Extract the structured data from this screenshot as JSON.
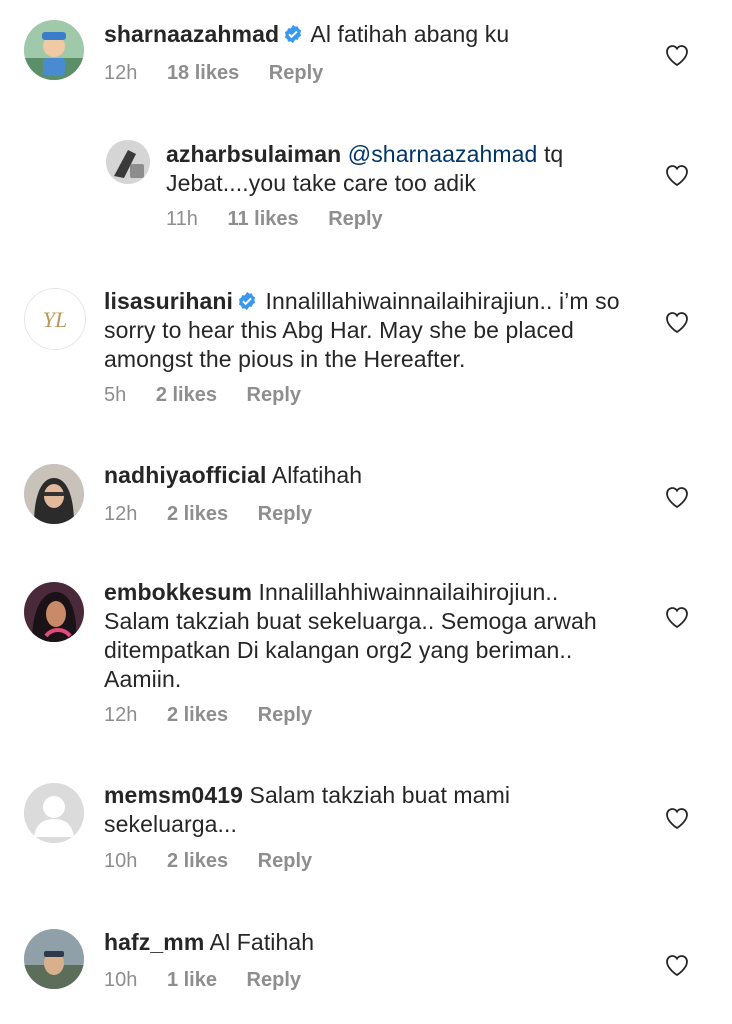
{
  "comments": [
    {
      "username": "sharnaazahmad",
      "verified": true,
      "text": "Al fatihah abang ku",
      "time": "12h",
      "likes": "18 likes",
      "reply": "Reply",
      "avatar_icon": "avatar-child-photo"
    },
    {
      "username": "azharbsulaiman",
      "verified": false,
      "mention": "@sharnaazahmad",
      "text": " tq Jebat....you take care too adik",
      "time": "11h",
      "likes": "11 likes",
      "reply": "Reply",
      "avatar_icon": "avatar-photo"
    },
    {
      "username": "lisasurihani",
      "verified": true,
      "text": "Innalillahiwainnailaihirajiun.. i’m so sorry to hear this Abg Har. May she be placed amongst the pious in the Hereafter.",
      "time": "5h",
      "likes": "2 likes",
      "reply": "Reply",
      "avatar_icon": "avatar-monogram-logo",
      "avatar_monogram": "YL"
    },
    {
      "username": "nadhiyaofficial",
      "verified": false,
      "text": "Alfatihah",
      "time": "12h",
      "likes": "2 likes",
      "reply": "Reply",
      "avatar_icon": "avatar-photo"
    },
    {
      "username": "embokkesum",
      "verified": false,
      "text": "Innalillahhiwainnailaihirojiun.. Salam takziah buat sekeluarga.. Semoga arwah ditempatkan Di kalangan org2 yang beriman.. Aamiin.",
      "time": "12h",
      "likes": "2 likes",
      "reply": "Reply",
      "avatar_icon": "avatar-photo"
    },
    {
      "username": "memsm0419",
      "verified": false,
      "text": "Salam takziah buat mami sekeluarga...",
      "time": "10h",
      "likes": "2 likes",
      "reply": "Reply",
      "avatar_icon": "default-avatar-icon"
    },
    {
      "username": "hafz_mm",
      "verified": false,
      "text": "Al Fatihah",
      "time": "10h",
      "likes": "1 like",
      "reply": "Reply",
      "avatar_icon": "avatar-photo"
    }
  ],
  "colors": {
    "verified": "#3897f0",
    "mention": "#003569",
    "meta": "#8e8e8e",
    "text": "#262626"
  }
}
